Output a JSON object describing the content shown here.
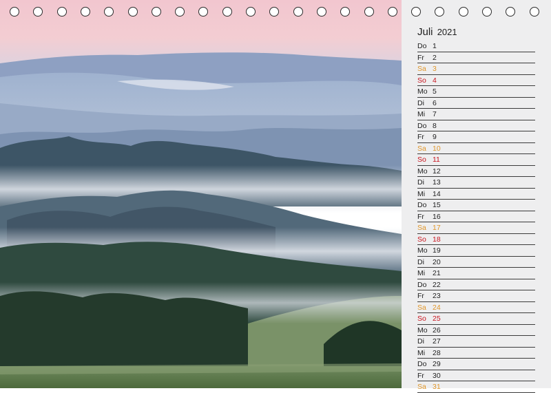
{
  "calendar": {
    "month": "Juli",
    "year": "2021",
    "ring_count": 23,
    "colors": {
      "weekday": "#1e1e1e",
      "saturday": "#e0962a",
      "sunday": "#c8141e",
      "panel_background": "#eeeeef"
    },
    "days": [
      {
        "weekday": "Do",
        "day": "1",
        "type": "weekday"
      },
      {
        "weekday": "Fr",
        "day": "2",
        "type": "weekday"
      },
      {
        "weekday": "Sa",
        "day": "3",
        "type": "sat"
      },
      {
        "weekday": "So",
        "day": "4",
        "type": "sun"
      },
      {
        "weekday": "Mo",
        "day": "5",
        "type": "weekday"
      },
      {
        "weekday": "Di",
        "day": "6",
        "type": "weekday"
      },
      {
        "weekday": "Mi",
        "day": "7",
        "type": "weekday"
      },
      {
        "weekday": "Do",
        "day": "8",
        "type": "weekday"
      },
      {
        "weekday": "Fr",
        "day": "9",
        "type": "weekday"
      },
      {
        "weekday": "Sa",
        "day": "10",
        "type": "sat"
      },
      {
        "weekday": "So",
        "day": "11",
        "type": "sun"
      },
      {
        "weekday": "Mo",
        "day": "12",
        "type": "weekday"
      },
      {
        "weekday": "Di",
        "day": "13",
        "type": "weekday"
      },
      {
        "weekday": "Mi",
        "day": "14",
        "type": "weekday"
      },
      {
        "weekday": "Do",
        "day": "15",
        "type": "weekday"
      },
      {
        "weekday": "Fr",
        "day": "16",
        "type": "weekday"
      },
      {
        "weekday": "Sa",
        "day": "17",
        "type": "sat"
      },
      {
        "weekday": "So",
        "day": "18",
        "type": "sun"
      },
      {
        "weekday": "Mo",
        "day": "19",
        "type": "weekday"
      },
      {
        "weekday": "Di",
        "day": "20",
        "type": "weekday"
      },
      {
        "weekday": "Mi",
        "day": "21",
        "type": "weekday"
      },
      {
        "weekday": "Do",
        "day": "22",
        "type": "weekday"
      },
      {
        "weekday": "Fr",
        "day": "23",
        "type": "weekday"
      },
      {
        "weekday": "Sa",
        "day": "24",
        "type": "sat"
      },
      {
        "weekday": "So",
        "day": "25",
        "type": "sun"
      },
      {
        "weekday": "Mo",
        "day": "26",
        "type": "weekday"
      },
      {
        "weekday": "Di",
        "day": "27",
        "type": "weekday"
      },
      {
        "weekday": "Mi",
        "day": "28",
        "type": "weekday"
      },
      {
        "weekday": "Do",
        "day": "29",
        "type": "weekday"
      },
      {
        "weekday": "Fr",
        "day": "30",
        "type": "weekday"
      },
      {
        "weekday": "Sa",
        "day": "31",
        "type": "sat"
      }
    ]
  }
}
